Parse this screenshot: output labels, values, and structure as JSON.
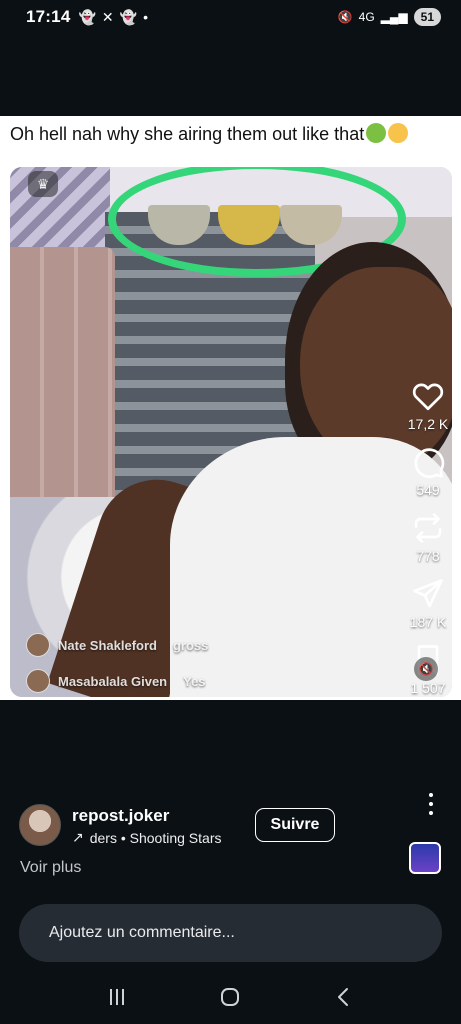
{
  "status_bar": {
    "time": "17:14",
    "left_icons": [
      "snapchat-icon",
      "x-icon",
      "snapchat-icon",
      "dot-icon"
    ],
    "network": "4G",
    "battery": "51"
  },
  "post": {
    "caption": "Oh hell nah why she airing them out like that",
    "caption_emojis": [
      "nauseated-face-emoji",
      "loudly-crying-face-emoji"
    ],
    "live_comments": [
      {
        "name": "Nate Shakleford",
        "text": "gross"
      },
      {
        "name": "Masabalala Given",
        "text": "Yes"
      }
    ],
    "highlight_color": "#35d67a"
  },
  "actions": {
    "likes": "17,2 K",
    "comments": "549",
    "reposts": "778",
    "shares": "187 K",
    "saves": "1 507"
  },
  "author": {
    "username": "repost.joker",
    "subtitle": "ders • Shooting Stars",
    "follow_label": "Suivre",
    "see_more": "Voir plus"
  },
  "comment_input": {
    "placeholder": "Ajoutez un commentaire..."
  },
  "colors": {
    "background": "#0b1014",
    "comment_bar": "#262c33",
    "accent_green": "#35d67a"
  }
}
